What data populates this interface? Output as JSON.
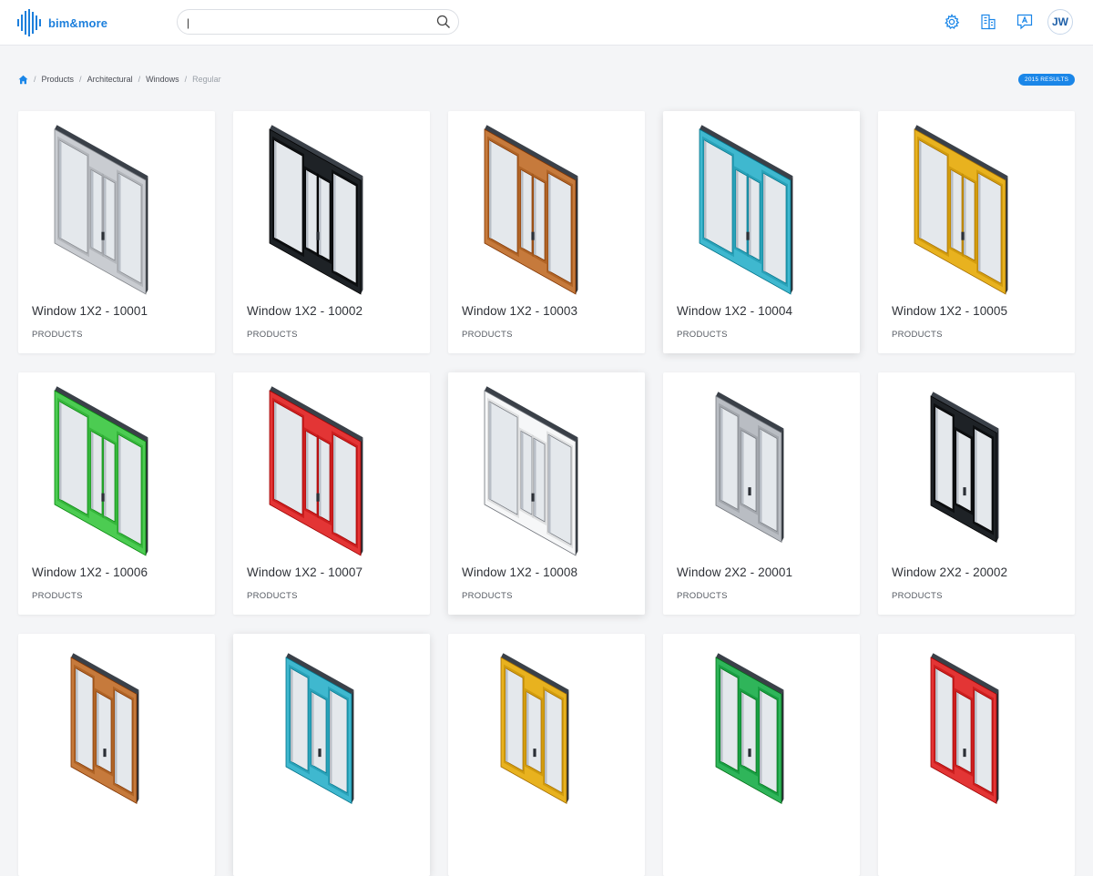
{
  "app": {
    "brand": "bim&more"
  },
  "search": {
    "value": "|",
    "placeholder": ""
  },
  "header_icons": [
    "gear-icon",
    "building-icon",
    "translate-icon"
  ],
  "user": {
    "initials": "JW"
  },
  "breadcrumb": {
    "items": [
      "Products",
      "Architectural",
      "Windows"
    ],
    "current": "Regular"
  },
  "results": {
    "label": "2015 RESULTS"
  },
  "colors": {
    "accent": "#1a86e8",
    "brand": "#1c7fdc"
  },
  "products": [
    {
      "title": "Window 1X2 - 10001",
      "category": "PRODUCTS",
      "frame_color": "#c9ccd1",
      "layout": "1x2"
    },
    {
      "title": "Window 1X2 - 10002",
      "category": "PRODUCTS",
      "frame_color": "#1e2226",
      "layout": "1x2"
    },
    {
      "title": "Window 1X2 - 10003",
      "category": "PRODUCTS",
      "frame_color": "#c67a3c",
      "layout": "1x2"
    },
    {
      "title": "Window 1X2 - 10004",
      "category": "PRODUCTS",
      "frame_color": "#3fb8cf",
      "layout": "1x2"
    },
    {
      "title": "Window 1X2 - 10005",
      "category": "PRODUCTS",
      "frame_color": "#e8b21f",
      "layout": "1x2"
    },
    {
      "title": "Window 1X2 - 10006",
      "category": "PRODUCTS",
      "frame_color": "#4ccc52",
      "layout": "1x2"
    },
    {
      "title": "Window 1X2 - 10007",
      "category": "PRODUCTS",
      "frame_color": "#e33535",
      "layout": "1x2"
    },
    {
      "title": "Window 1X2 - 10008",
      "category": "PRODUCTS",
      "frame_color": "#f6f7f8",
      "layout": "1x2"
    },
    {
      "title": "Window 2X2 - 20001",
      "category": "PRODUCTS",
      "frame_color": "#b9bdc3",
      "layout": "2x2"
    },
    {
      "title": "Window 2X2 - 20002",
      "category": "PRODUCTS",
      "frame_color": "#1e2226",
      "layout": "2x2"
    },
    {
      "title": "",
      "category": "",
      "frame_color": "#c67a3c",
      "layout": "2x2"
    },
    {
      "title": "",
      "category": "",
      "frame_color": "#3fb8cf",
      "layout": "2x2"
    },
    {
      "title": "",
      "category": "",
      "frame_color": "#e8b21f",
      "layout": "2x2"
    },
    {
      "title": "",
      "category": "",
      "frame_color": "#2fb55a",
      "layout": "2x2"
    },
    {
      "title": "",
      "category": "",
      "frame_color": "#e33535",
      "layout": "2x2"
    }
  ]
}
